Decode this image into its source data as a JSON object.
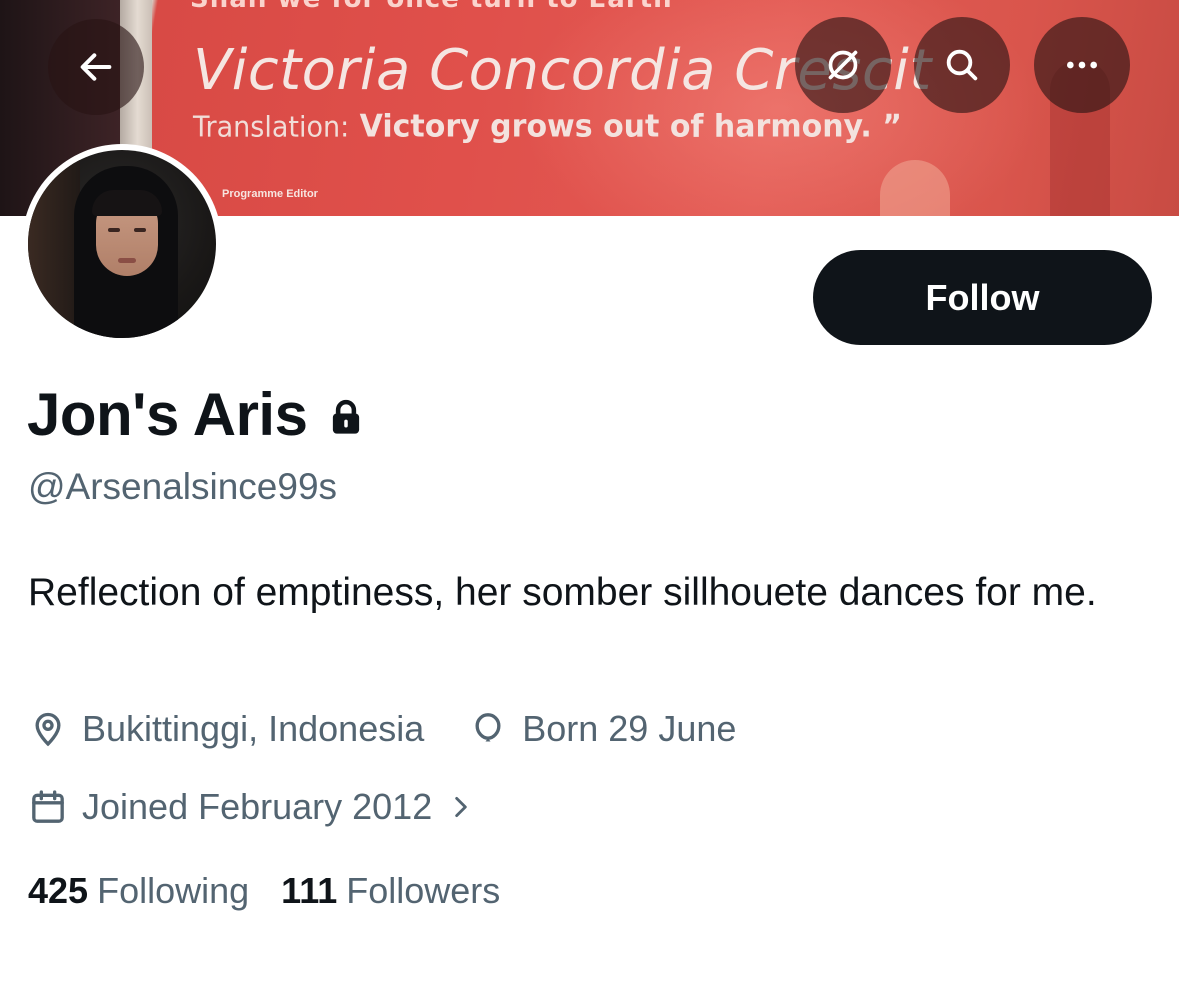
{
  "banner": {
    "top_text": "Shall we for once turn to Earth",
    "motto": "Victoria Concordia Crescit",
    "translation_label": "Translation:",
    "translation_text": "Victory grows out of harmony.",
    "quote_mark": "”",
    "caption": "Programme Editor"
  },
  "nav": {
    "back_icon": "arrow-left-icon",
    "grok_icon": "slash-circle-icon",
    "search_icon": "search-icon",
    "more_icon": "more-horizontal-icon"
  },
  "profile": {
    "follow_label": "Follow",
    "display_name": "Jon's Aris",
    "protected_icon": "lock-icon",
    "handle": "@Arsenalsince99s",
    "bio": "Reflection of emptiness, her somber sillhouete dances for me.",
    "location": "Bukittinggi, Indonesia",
    "birthday": "Born 29 June",
    "joined": "Joined February 2012",
    "following_count": "425",
    "following_label": "Following",
    "followers_count": "111",
    "followers_label": "Followers"
  },
  "colors": {
    "primary_text": "#0f1419",
    "secondary_text": "#536471",
    "follow_button_bg": "#0f1419",
    "banner_red": "#e0504b"
  }
}
